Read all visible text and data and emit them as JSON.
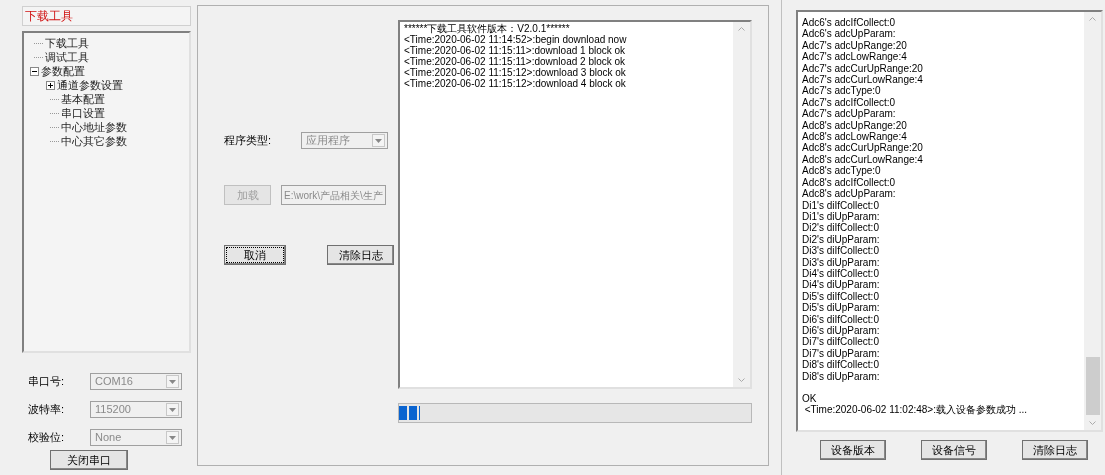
{
  "left_panel": {
    "title": "下载工具",
    "tree": [
      {
        "label": "下载工具"
      },
      {
        "label": "调试工具"
      },
      {
        "label": "参数配置",
        "expanded": true,
        "children": [
          {
            "label": "通道参数设置",
            "expanded": false
          },
          {
            "label": "基本配置"
          },
          {
            "label": "串口设置"
          },
          {
            "label": "中心地址参数"
          },
          {
            "label": "中心其它参数"
          }
        ]
      }
    ],
    "serial_fields": [
      {
        "label": "串口号:",
        "value": "COM16",
        "disabled": true
      },
      {
        "label": "波特率:",
        "value": "115200",
        "disabled": true
      },
      {
        "label": "校验位:",
        "value": "None",
        "disabled": true
      }
    ],
    "close_button": "关闭串口"
  },
  "middle_panel": {
    "program_type": {
      "label": "程序类型:",
      "value": "应用程序",
      "disabled": true
    },
    "load_button": {
      "label": "加载",
      "disabled": true
    },
    "path_field": {
      "value": "E:\\work\\产品相关\\生产",
      "disabled": true
    },
    "cancel_button": {
      "label": "取消",
      "focused": true
    },
    "clear_button": {
      "label": "清除日志",
      "focused": false
    },
    "log": [
      "******下载工具软件版本：V2.0.1******",
      "<Time:2020-06-02 11:14:52>:begin download  now",
      "<Time:2020-06-02 11:15:11>:download 1 block ok",
      "<Time:2020-06-02 11:15:11>:download 2 block ok",
      "<Time:2020-06-02 11:15:12>:download 3 block ok",
      "<Time:2020-06-02 11:15:12>:download 4 block ok"
    ],
    "progress": {
      "level": 0.06
    }
  },
  "right_panel": {
    "log": [
      "Adc6's adcIfCollect:0",
      "Adc6's adcUpParam:",
      "Adc7's adcUpRange:20",
      "Adc7's adcLowRange:4",
      "Adc7's adcCurUpRange:20",
      "Adc7's adcCurLowRange:4",
      "Adc7's adcType:0",
      "Adc7's adcIfCollect:0",
      "Adc7's adcUpParam:",
      "Adc8's adcUpRange:20",
      "Adc8's adcLowRange:4",
      "Adc8's adcCurUpRange:20",
      "Adc8's adcCurLowRange:4",
      "Adc8's adcType:0",
      "Adc8's adcIfCollect:0",
      "Adc8's adcUpParam:",
      "Di1's diIfCollect:0",
      "Di1's diUpParam:",
      "Di2's diIfCollect:0",
      "Di2's diUpParam:",
      "Di3's diIfCollect:0",
      "Di3's diUpParam:",
      "Di4's diIfCollect:0",
      "Di4's diUpParam:",
      "Di5's diIfCollect:0",
      "Di5's diUpParam:",
      "Di6's diIfCollect:0",
      "Di6's diUpParam:",
      "Di7's diIfCollect:0",
      "Di7's diUpParam:",
      "Di8's diIfCollect:0",
      "Di8's diUpParam:"
    ],
    "log_end": [
      "OK",
      " <Time:2020-06-02 11:02:48>:载入设备参数成功 ..."
    ],
    "buttons": [
      "设备版本",
      "设备信号",
      "清除日志"
    ]
  }
}
